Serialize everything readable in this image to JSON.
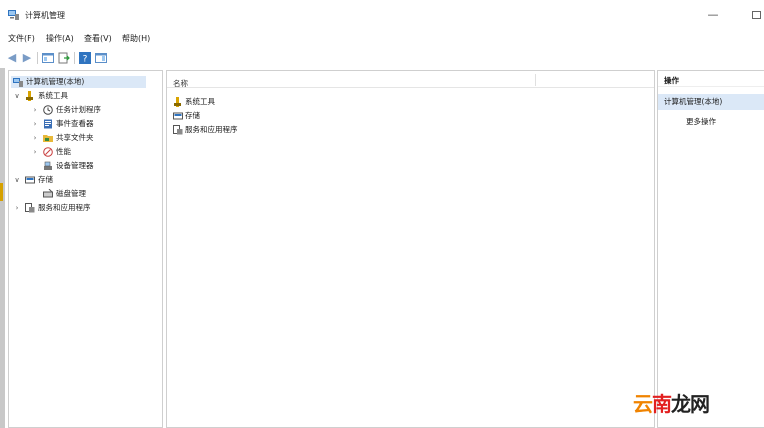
{
  "window": {
    "title": "计算机管理",
    "minimize_glyph": "—"
  },
  "menubar": {
    "items": [
      "文件(F)",
      "操作(A)",
      "查看(V)",
      "帮助(H)"
    ]
  },
  "toolbar": {
    "buttons": [
      "back-arrow-icon",
      "forward-arrow-icon",
      "show-hide-console-tree-icon",
      "export-list-icon",
      "help-icon",
      "properties-pane-icon"
    ]
  },
  "tree": {
    "root": "计算机管理(本地)",
    "system_tools": "系统工具",
    "task_scheduler": "任务计划程序",
    "event_viewer": "事件查看器",
    "shared_folders": "共享文件夹",
    "performance": "性能",
    "device_manager": "设备管理器",
    "storage": "存储",
    "disk_management": "磁盘管理",
    "services_apps": "服务和应用程序"
  },
  "center": {
    "column_name": "名称",
    "items": [
      "系统工具",
      "存储",
      "服务和应用程序"
    ]
  },
  "actions": {
    "header": "操作",
    "section": "计算机管理(本地)",
    "more": "更多操作"
  },
  "watermark": {
    "part1": "云",
    "part2": "南",
    "part3": "龙网"
  },
  "colors": {
    "selection": "#dbe8f7",
    "accent_blue": "#2f74c0",
    "watermark_orange": "#f08300",
    "watermark_red": "#e21f1f"
  }
}
